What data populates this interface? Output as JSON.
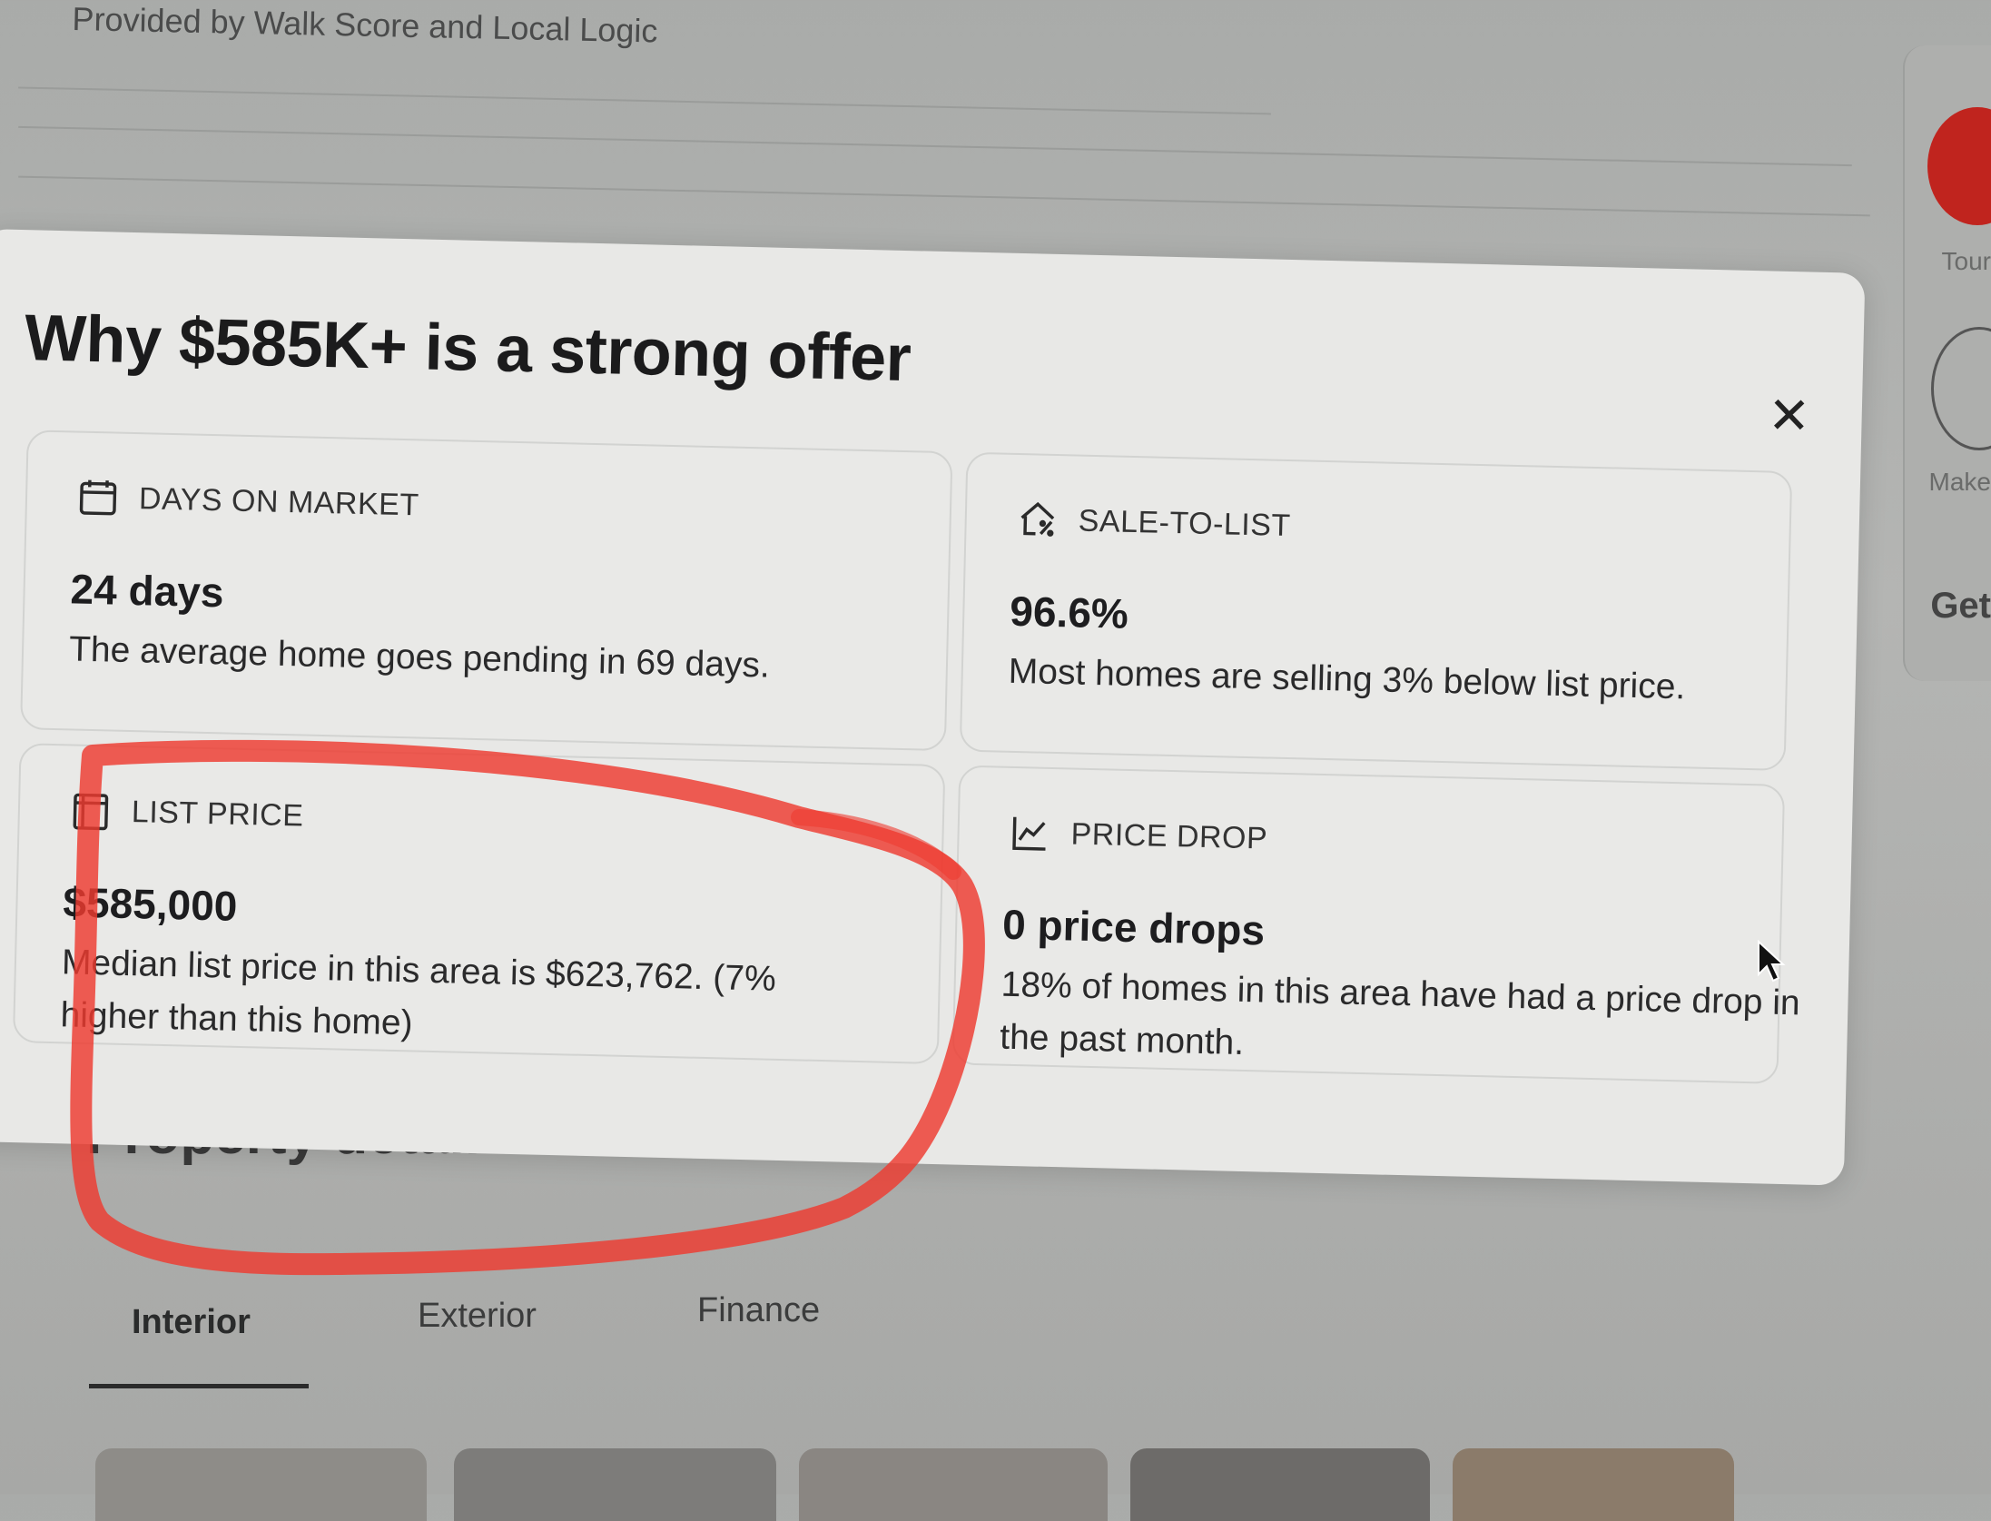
{
  "background": {
    "provided_by": "Provided by Walk Score and Local Logic",
    "side_labels": {
      "tour": "Tour",
      "make": "Make",
      "get": "Get"
    },
    "section_heading": "Property details",
    "tabs": [
      {
        "label": "Interior",
        "active": true
      },
      {
        "label": "Exterior",
        "active": false
      },
      {
        "label": "Finance",
        "active": false
      }
    ]
  },
  "modal": {
    "title": "Why $585K+ is a strong offer",
    "close_symbol": "✕",
    "cards": {
      "days_on_market": {
        "label": "DAYS ON MARKET",
        "icon": "calendar-icon",
        "value": "24 days",
        "description": "The average home goes pending in 69 days."
      },
      "sale_to_list": {
        "label": "SALE-TO-LIST",
        "icon": "house-percent-icon",
        "value": "96.6%",
        "description": "Most homes are selling 3% below list price."
      },
      "list_price": {
        "label": "LIST PRICE",
        "icon": "price-tag-icon",
        "value": "$585,000",
        "description": "Median list price in this area is $623,762. (7% higher than this home)"
      },
      "price_drop": {
        "label": "PRICE DROP",
        "icon": "line-chart-icon",
        "value": "0 price drops",
        "description": "18% of homes in this area have had a price drop in the past month."
      }
    }
  },
  "colors": {
    "annotation_red": "#ee3b30",
    "modal_bg": "#e8e8e6",
    "brand_red": "#c0241e"
  }
}
